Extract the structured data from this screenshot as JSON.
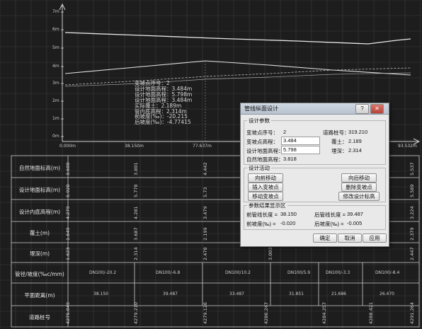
{
  "y_axis": {
    "ticks": [
      "7m",
      "6m",
      "5m",
      "4m",
      "3m",
      "2m",
      "1m",
      "0m"
    ]
  },
  "x_axis": {
    "ticks": [
      "0.000m",
      "38.150m",
      "77.637m",
      "",
      "",
      "",
      "",
      "93.532m"
    ]
  },
  "annotation": {
    "lines": [
      "变坡点序号：2",
      "设计地面高程：3.484m",
      "设计地面高程：5.798m",
      "设计地面高程：3.484m",
      "实际覆土：2.189m",
      "管内底高程：2.314m",
      "前坡度(‰)：-20.215",
      "后坡度(‰)：-4.77415"
    ]
  },
  "table": {
    "row_labels": [
      "自然地面标高(m)",
      "设计地面标高(m)",
      "设计内底高程(m)",
      "覆土(m)",
      "埋深(m)",
      "管径/坡度(‰c/mm)",
      "平面距离(m)",
      "道路桩号"
    ],
    "values": {
      "natural_ground": [
        "3.600",
        "3.801",
        "4.442",
        "",
        "",
        "",
        "",
        "",
        "5.537"
      ],
      "design_ground": [
        "5.928",
        "5.778",
        "5.73",
        "",
        "",
        "",
        "",
        "",
        "5.589"
      ],
      "invert": [
        "4.279",
        "4.281",
        "3.479",
        "",
        "",
        "",
        "",
        "",
        "3.224"
      ],
      "cover": [
        "1.649",
        "3.687",
        "2.199",
        "",
        "",
        "",
        "",
        "",
        "2.379"
      ],
      "depth": [
        "1.623",
        "2.314",
        "2.478",
        "3.003",
        "",
        "",
        "",
        "",
        "2.447"
      ],
      "pipe_slope": [
        "DN100/-20.2",
        "DN100/-6.8",
        "DN100/10.2",
        "DN100/5.9",
        "DN100/-3.3",
        "DN100/-8.4"
      ],
      "plan_distance": [
        "38.150",
        "39.487",
        "33.487",
        "31.851",
        "21.686",
        "26.470"
      ],
      "station": [
        "4275.049",
        "4279.210",
        "4279.126",
        "4286.247",
        "4284.257",
        "4288.421",
        "4291.264"
      ]
    }
  },
  "dialog": {
    "title": "管线纵面设计",
    "help_label": "?",
    "close_label": "✕",
    "design_params": {
      "legend": "设计参数",
      "point_no_label": "变坡点序号：",
      "point_no_value": "2",
      "road_station_label": "道路桩号：",
      "road_station_value": "319.210",
      "point_elev_label": "变坡点高程：",
      "point_elev_value": "3.484",
      "cover_label": "覆土：",
      "cover_value": "2.189",
      "design_ground_label": "设计地面高程：",
      "design_ground_value": "5.798",
      "depth_label": "埋深：",
      "depth_value": "2.314",
      "natural_ground_label": "自然地面高程：",
      "natural_ground_value": "3.818"
    },
    "design_actions": {
      "legend": "设计活动",
      "move_forward": "向前移动",
      "move_backward": "向后移动",
      "insert_point": "插入变坡点",
      "delete_point": "删除变坡点",
      "move_point": "移动变坡点",
      "edit_elevation": "修改设计标高"
    },
    "results": {
      "legend": "参数结果显示区",
      "front_len_label": "前管线长度 =",
      "front_len_value": "38.150",
      "back_len_label": "后管线长度 =",
      "back_len_value": "39.487",
      "front_slope_label": "前坡度(‰) =",
      "front_slope_value": "-0.020",
      "back_slope_label": "后坡度(‰) =",
      "back_slope_value": "-0.005"
    },
    "ok": "确定",
    "cancel": "取消",
    "apply": "应用"
  }
}
